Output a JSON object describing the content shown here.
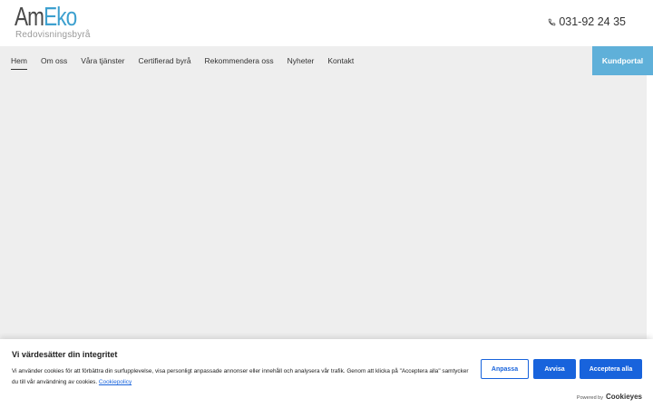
{
  "header": {
    "logo_main_1": "Am",
    "logo_main_2": "Eko",
    "logo_sub": "Redovisningsbyrå",
    "phone": "031-92 24 35",
    "phone_icon": "phone-icon"
  },
  "nav": {
    "items": [
      {
        "label": "Hem",
        "active": true
      },
      {
        "label": "Om oss"
      },
      {
        "label": "Våra tjänster"
      },
      {
        "label": "Certifierad byrå"
      },
      {
        "label": "Rekommendera oss"
      },
      {
        "label": "Nyheter"
      },
      {
        "label": "Kontakt"
      }
    ],
    "portal_label": "Kundportal"
  },
  "cookie": {
    "title": "Vi värdesätter din integritet",
    "text": "Vi använder cookies för att förbättra din surfupplevelse, visa personligt anpassade annonser eller innehåll och analysera vår trafik. Genom att klicka på \"Acceptera alla\" samtycker du till vår användning av cookies.",
    "link": "Cookiepolicy",
    "customize": "Anpassa",
    "reject": "Avvisa",
    "accept": "Acceptera alla",
    "powered_by": "Powered by",
    "brand": "Cookieyes"
  },
  "colors": {
    "accent": "#5fb0d9",
    "logo_blue": "#3da0cf",
    "cookie_blue": "#1863dc",
    "nav_bg": "#eeeeee"
  }
}
